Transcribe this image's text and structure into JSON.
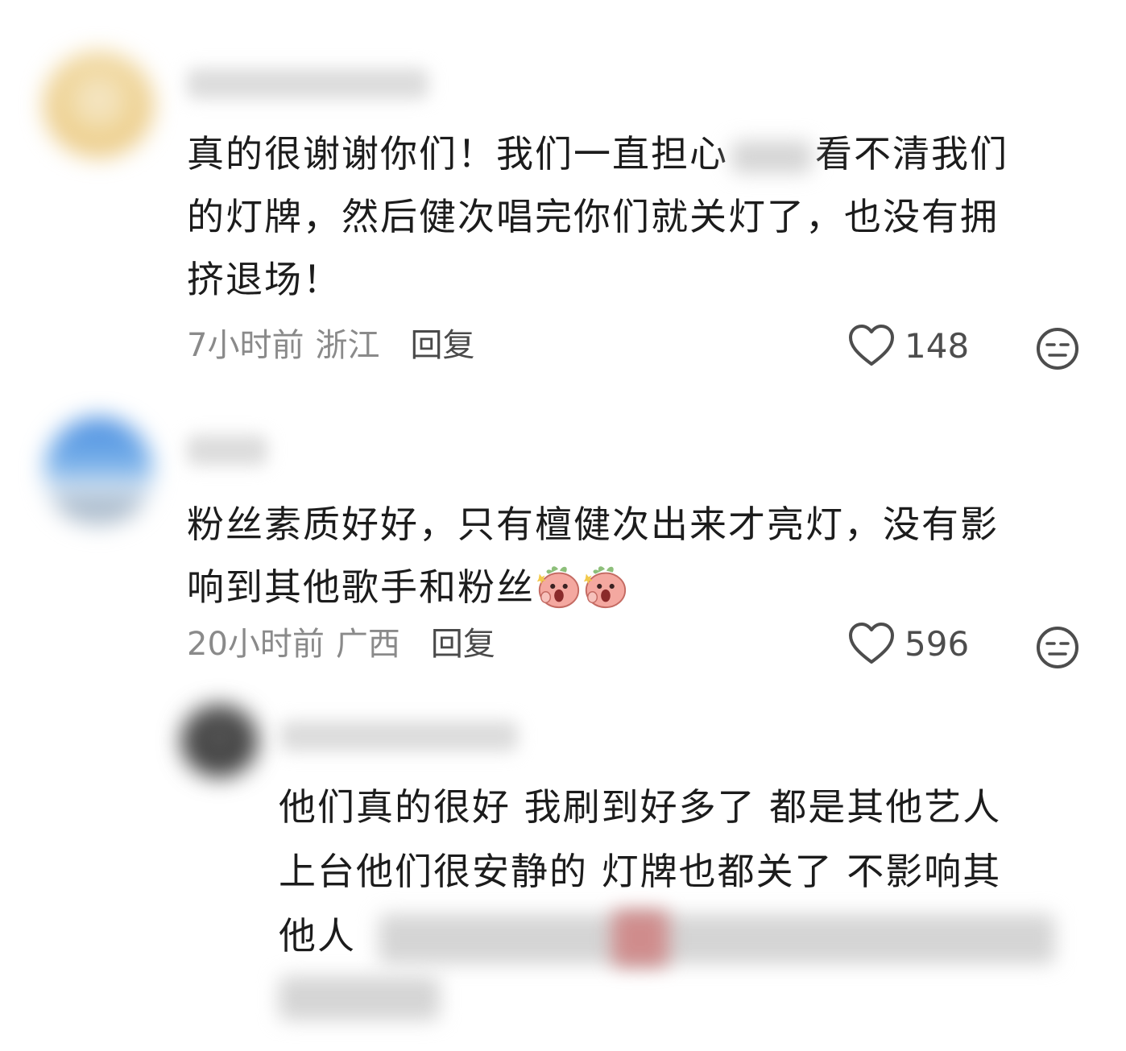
{
  "comments": [
    {
      "text_lines": [
        "真的很谢谢你们！我们一直担心",
        "看不清我们",
        "的灯牌，然后健次唱完你们就关灯了，也没有拥",
        "挤退场！"
      ],
      "time": "7小时前",
      "location": "浙江",
      "reply_label": "回复",
      "likes": "148"
    },
    {
      "text_lines": [
        "粉丝素质好好，只有檀健次出来才亮灯，没有影",
        "响到其他歌手和粉丝"
      ],
      "time": "20小时前",
      "location": "广西",
      "reply_label": "回复",
      "likes": "596"
    },
    {
      "text_lines": [
        "他们真的很好 我刷到好多了 都是其他艺人",
        "上台他们很安静的 灯牌也都关了 不影响其",
        "他人"
      ]
    }
  ],
  "icons": {
    "like": "heart-outline-icon",
    "dislike": "meh-face-icon",
    "emoji": "shocked-peach-emoji"
  },
  "colors": {
    "text": "#1c1c1c",
    "meta": "#8a8a8a",
    "reply": "#4a4a4a"
  }
}
